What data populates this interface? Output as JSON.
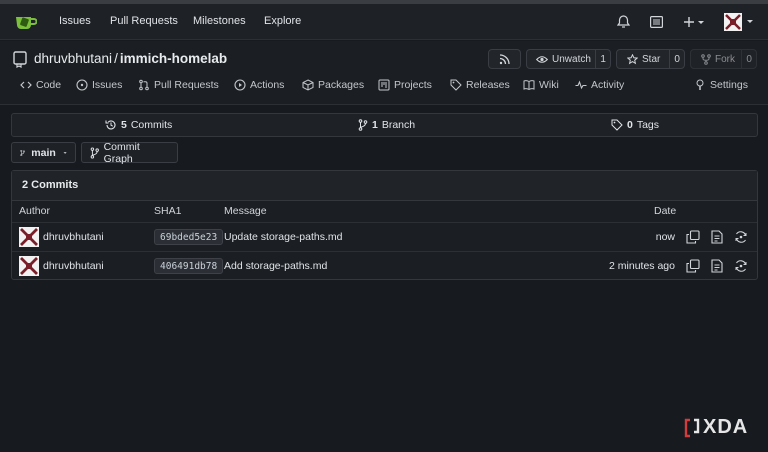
{
  "nav": {
    "links": [
      "Issues",
      "Pull Requests",
      "Milestones",
      "Explore"
    ]
  },
  "repo": {
    "owner": "dhruvbhutani",
    "separator": "/",
    "name": "immich-homelab",
    "watch_label": "Unwatch",
    "watch_count": "1",
    "star_label": "Star",
    "star_count": "0",
    "fork_label": "Fork",
    "fork_count": "0"
  },
  "tabs": {
    "code": "Code",
    "issues": "Issues",
    "pulls": "Pull Requests",
    "actions": "Actions",
    "packages": "Packages",
    "projects": "Projects",
    "releases": "Releases",
    "wiki": "Wiki",
    "activity": "Activity",
    "settings": "Settings"
  },
  "summary": {
    "commits_count": "5",
    "commits_label": "Commits",
    "branch_count": "1",
    "branch_label": "Branch",
    "tags_count": "0",
    "tags_label": "Tags"
  },
  "controls": {
    "branch": "main",
    "graph": "Commit Graph"
  },
  "commits": {
    "title": "2 Commits",
    "headers": {
      "author": "Author",
      "sha": "SHA1",
      "message": "Message",
      "date": "Date"
    },
    "rows": [
      {
        "author": "dhruvbhutani",
        "sha": "69bded5e23",
        "message": "Update storage-paths.md",
        "date": "now"
      },
      {
        "author": "dhruvbhutani",
        "sha": "406491db78",
        "message": "Add storage-paths.md",
        "date": "2 minutes ago"
      }
    ]
  },
  "watermark": "XDA",
  "colors": {
    "background": "#171a1e",
    "logo": "#609926"
  }
}
